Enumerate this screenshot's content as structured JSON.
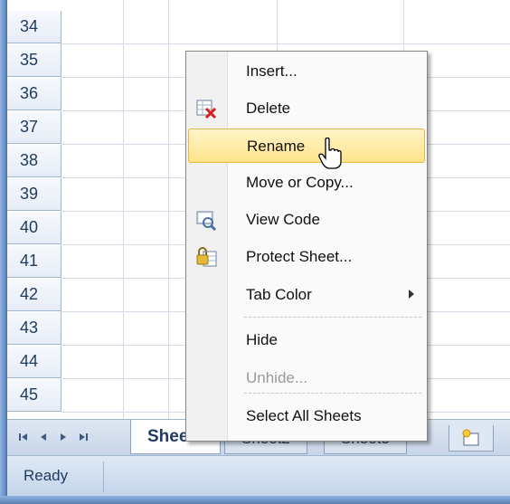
{
  "rows": [
    "34",
    "35",
    "36",
    "37",
    "38",
    "39",
    "40",
    "41",
    "42",
    "43",
    "44",
    "45"
  ],
  "context_menu": {
    "items": [
      {
        "label": "Insert...",
        "icon": "",
        "disabled": false,
        "hover": false,
        "submenu": false
      },
      {
        "label": "Delete",
        "icon": "delete-sheet-icon",
        "disabled": false,
        "hover": false,
        "submenu": false
      },
      {
        "label": "Rename",
        "icon": "",
        "disabled": false,
        "hover": true,
        "submenu": false
      },
      {
        "label": "Move or Copy...",
        "icon": "",
        "disabled": false,
        "hover": false,
        "submenu": false
      },
      {
        "label": "View Code",
        "icon": "view-code-icon",
        "disabled": false,
        "hover": false,
        "submenu": false
      },
      {
        "label": "Protect Sheet...",
        "icon": "protect-sheet-icon",
        "disabled": false,
        "hover": false,
        "submenu": false
      },
      {
        "label": "Tab Color",
        "icon": "",
        "disabled": false,
        "hover": false,
        "submenu": true
      },
      {
        "label": "Hide",
        "icon": "",
        "disabled": false,
        "hover": false,
        "submenu": false
      },
      {
        "label": "Unhide...",
        "icon": "",
        "disabled": true,
        "hover": false,
        "submenu": false
      },
      {
        "label": "Select All Sheets",
        "icon": "",
        "disabled": false,
        "hover": false,
        "submenu": false
      }
    ]
  },
  "sheet_tabs": [
    {
      "label": "Sheet1",
      "active": true
    },
    {
      "label": "Sheet2",
      "active": false
    },
    {
      "label": "Sheet3",
      "active": false
    }
  ],
  "tab_nav": {
    "first": "⏮",
    "prev": "◀",
    "next": "▶",
    "last": "⏭"
  },
  "status": {
    "text": "Ready"
  },
  "colors": {
    "accent": "#ffe48a",
    "header_text": "#1f3a5f"
  }
}
